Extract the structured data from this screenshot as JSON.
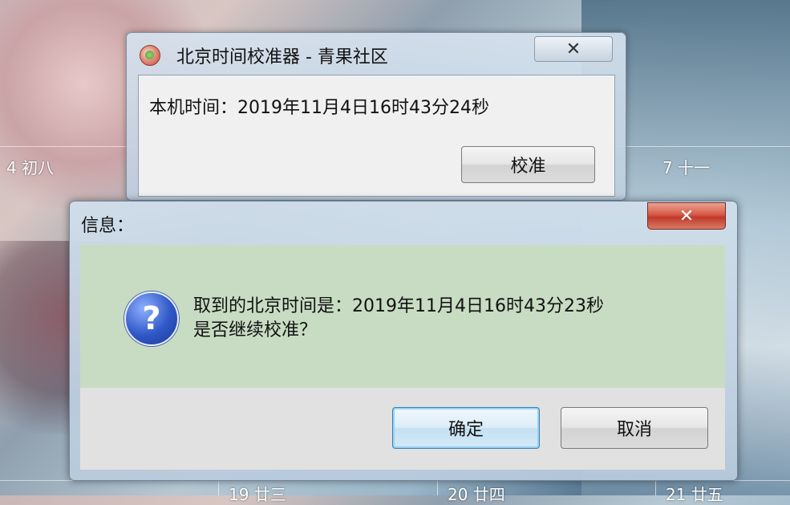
{
  "calendar": {
    "cell_left": "4  初八",
    "cell_right": "7  十一",
    "bottom_1": "19  廿三",
    "bottom_2": "20  廿四",
    "bottom_3": "21  廿五"
  },
  "main_window": {
    "title": "北京时间校准器 - 青果社区",
    "close_label": "✕",
    "local_time": "本机时间：2019年11月4日16时43分24秒",
    "calibrate_label": "校准"
  },
  "dialog": {
    "title": "信息：",
    "close_label": "✕",
    "icon_glyph": "?",
    "message_line1": "取到的北京时间是：2019年11月4日16时43分23秒",
    "message_line2": "是否继续校准？",
    "ok_label": "确定",
    "cancel_label": "取消"
  }
}
